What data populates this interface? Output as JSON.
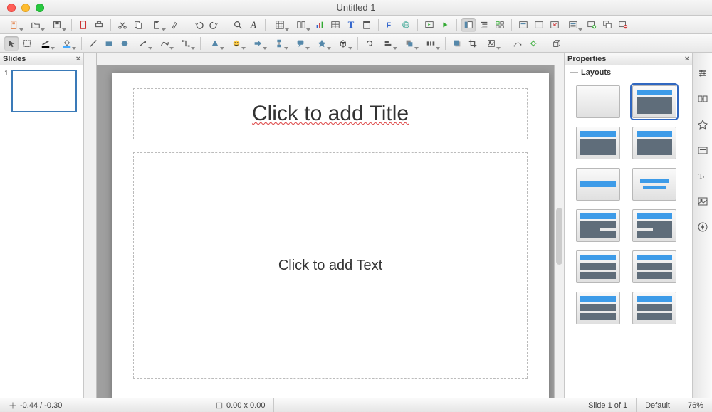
{
  "window": {
    "title": "Untitled 1"
  },
  "panels": {
    "slides": {
      "title": "Slides"
    },
    "properties": {
      "title": "Properties",
      "section": "Layouts"
    }
  },
  "slides": [
    {
      "number": "1"
    }
  ],
  "slide": {
    "title_placeholder": "Click to add Title",
    "content_placeholder": "Click to add Text"
  },
  "layouts": [
    {
      "name": "blank",
      "selected": false
    },
    {
      "name": "title-content",
      "selected": true
    },
    {
      "name": "title-content-full",
      "selected": false
    },
    {
      "name": "title-two-content",
      "selected": false
    },
    {
      "name": "title-only",
      "selected": false
    },
    {
      "name": "centered",
      "selected": false
    },
    {
      "name": "two-content-header",
      "selected": false
    },
    {
      "name": "two-content-two-header",
      "selected": false
    },
    {
      "name": "content-over-two",
      "selected": false
    },
    {
      "name": "two-over-content",
      "selected": false
    },
    {
      "name": "grid-four",
      "selected": false
    },
    {
      "name": "grid-six",
      "selected": false
    }
  ],
  "status": {
    "coords": "-0.44 / -0.30",
    "size": "0.00 x 0.00",
    "slide_info": "Slide 1 of 1",
    "master": "Default",
    "zoom": "76%"
  }
}
